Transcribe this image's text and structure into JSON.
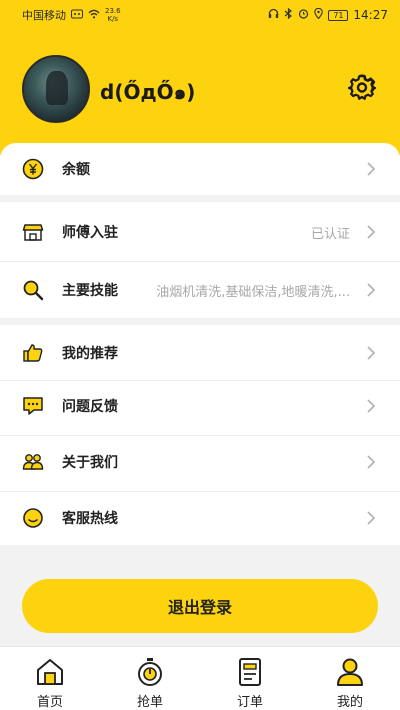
{
  "status_bar": {
    "carrier": "中国移动",
    "net_speed_value": "23.6",
    "net_speed_unit": "K/s",
    "battery": "71",
    "time": "14:27"
  },
  "profile": {
    "username": "d(ŐдŐ๑)"
  },
  "balance": {
    "label": "余额"
  },
  "master": {
    "entry_label": "师傅入驻",
    "entry_status": "已认证",
    "skills_label": "主要技能",
    "skills_value": "油烟机清洗,基础保洁,地暖清洗,..."
  },
  "menu": {
    "items": [
      {
        "label": "我的推荐"
      },
      {
        "label": "问题反馈"
      },
      {
        "label": "关于我们"
      },
      {
        "label": "客服热线"
      }
    ]
  },
  "logout_label": "退出登录",
  "tabs": [
    {
      "label": "首页"
    },
    {
      "label": "抢单"
    },
    {
      "label": "订单"
    },
    {
      "label": "我的"
    }
  ],
  "colors": {
    "accent": "#fdd30f",
    "background": "#f2f2f2"
  },
  "icons": [
    "wechat-icon",
    "wifi-icon",
    "headphone-icon",
    "bluetooth-icon",
    "alarm-icon",
    "location-icon",
    "settings-icon",
    "yen-icon",
    "store-icon",
    "search-icon",
    "thumbs-up-icon",
    "message-icon",
    "users-icon",
    "smiley-icon",
    "chevron-right-icon",
    "home-icon",
    "stopwatch-icon",
    "document-icon",
    "person-icon"
  ]
}
